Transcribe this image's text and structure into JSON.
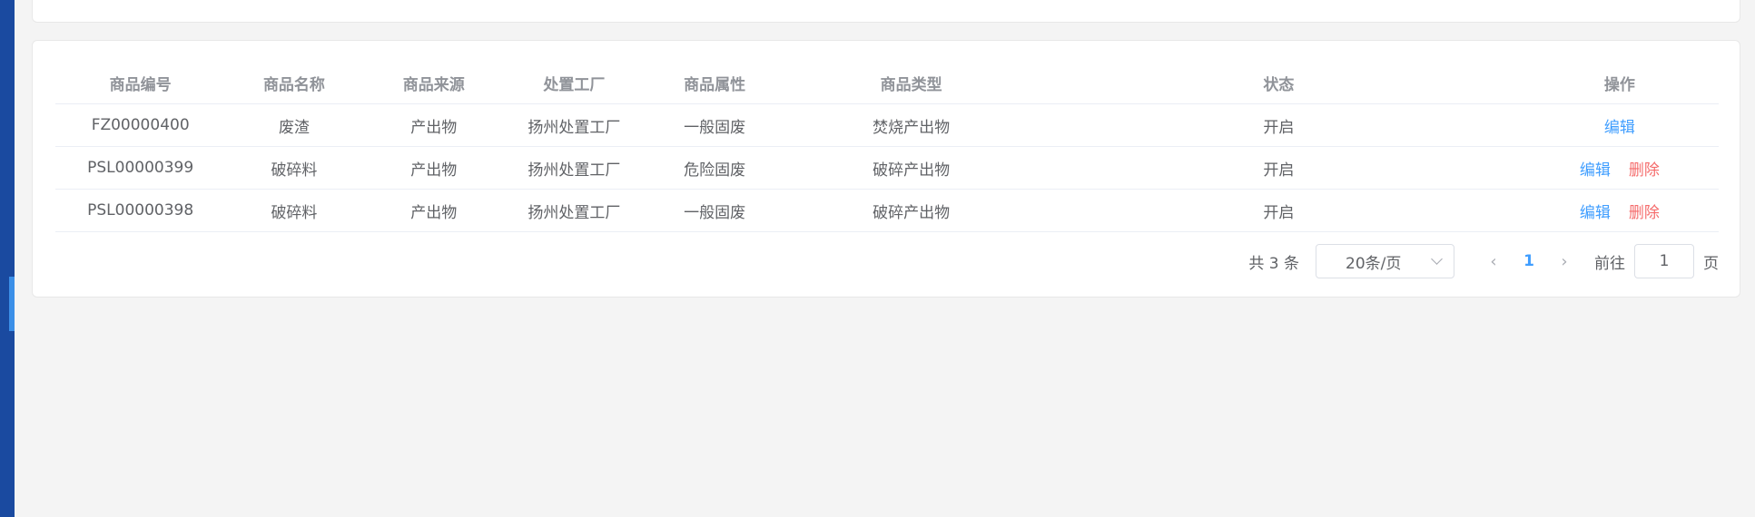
{
  "table": {
    "columns": [
      "商品编号",
      "商品名称",
      "商品来源",
      "处置工厂",
      "商品属性",
      "商品类型",
      "状态",
      "操作"
    ],
    "rows": [
      {
        "code": "FZ00000400",
        "name": "废渣",
        "source": "产出物",
        "factory": "扬州处置工厂",
        "attr": "一般固废",
        "type": "焚烧产出物",
        "status": "开启",
        "edit": "编辑"
      },
      {
        "code": "PSL00000399",
        "name": "破碎料",
        "source": "产出物",
        "factory": "扬州处置工厂",
        "attr": "危险固废",
        "type": "破碎产出物",
        "status": "开启",
        "edit": "编辑",
        "delete": "删除"
      },
      {
        "code": "PSL00000398",
        "name": "破碎料",
        "source": "产出物",
        "factory": "扬州处置工厂",
        "attr": "一般固废",
        "type": "破碎产出物",
        "status": "开启",
        "edit": "编辑",
        "delete": "删除"
      }
    ]
  },
  "pagination": {
    "total": "共 3 条",
    "page_size": "20条/页",
    "prev": "‹",
    "current": "1",
    "next": "›",
    "goto_label": "前往",
    "goto_value": "1",
    "unit": "页"
  },
  "colors": {
    "link": "#409eff",
    "danger": "#f56c6c",
    "sidebar": "#1a4aa0"
  }
}
